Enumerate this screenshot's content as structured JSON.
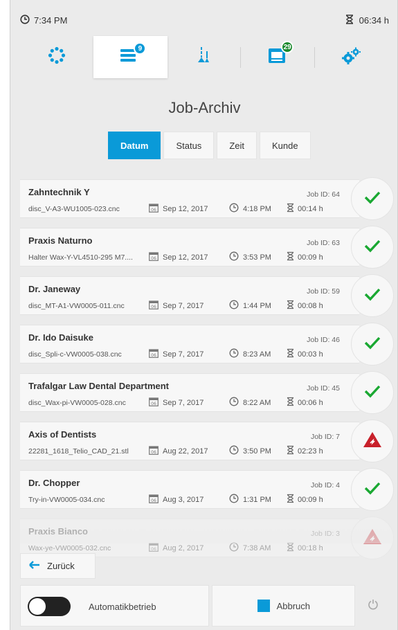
{
  "status_bar": {
    "time": "7:34 PM",
    "remaining": "06:34 h"
  },
  "nav": {
    "tabs": [
      {
        "icon": "dots-circle-icon",
        "badge": ""
      },
      {
        "icon": "job-list-icon",
        "badge": "9"
      },
      {
        "icon": "tools-icon",
        "badge": ""
      },
      {
        "icon": "machine-icon",
        "badge": "29"
      },
      {
        "icon": "gears-icon",
        "badge": ""
      }
    ],
    "active_index": 1
  },
  "page_title": "Job-Archiv",
  "sort": {
    "options": [
      "Datum",
      "Status",
      "Zeit",
      "Kunde"
    ],
    "active": "Datum"
  },
  "jobs": [
    {
      "customer": "Zahntechnik Y",
      "file": "disc_V-A3-WU1005-023.cnc",
      "date": "Sep 12, 2017",
      "time": "4:18 PM",
      "duration": "00:14 h",
      "job_id": "Job ID: 64",
      "status": "success"
    },
    {
      "customer": "Praxis Naturno",
      "file": "Halter Wax-Y-VL4510-295 M7....",
      "date": "Sep 12, 2017",
      "time": "3:53 PM",
      "duration": "00:09 h",
      "job_id": "Job ID: 63",
      "status": "success"
    },
    {
      "customer": "Dr. Janeway",
      "file": "disc_MT-A1-VW0005-011.cnc",
      "date": "Sep 7, 2017",
      "time": "1:44 PM",
      "duration": "00:08 h",
      "job_id": "Job ID: 59",
      "status": "success"
    },
    {
      "customer": "Dr. Ido Daisuke",
      "file": "disc_Spli-c-VW0005-038.cnc",
      "date": "Sep 7, 2017",
      "time": "8:23 AM",
      "duration": "00:03 h",
      "job_id": "Job ID: 46",
      "status": "success"
    },
    {
      "customer": "Trafalgar Law Dental Department",
      "file": "disc_Wax-pi-VW0005-028.cnc",
      "date": "Sep 7, 2017",
      "time": "8:22 AM",
      "duration": "00:06 h",
      "job_id": "Job ID: 45",
      "status": "success"
    },
    {
      "customer": "Axis of Dentists",
      "file": "22281_1618_Telio_CAD_21.stl",
      "date": "Aug 22, 2017",
      "time": "3:50 PM",
      "duration": "02:23 h",
      "job_id": "Job ID: 7",
      "status": "error"
    },
    {
      "customer": "Dr. Chopper",
      "file": "Try-in-VW0005-034.cnc",
      "date": "Aug 3, 2017",
      "time": "1:31 PM",
      "duration": "00:09 h",
      "job_id": "Job ID: 4",
      "status": "success"
    },
    {
      "customer": "Praxis Bianco",
      "file": "Wax-ye-VW0005-032.cnc",
      "date": "Aug 2, 2017",
      "time": "7:38 AM",
      "duration": "00:18 h",
      "job_id": "Job ID: 3",
      "status": "error"
    }
  ],
  "calendar_day": "06",
  "back_label": "Zurück",
  "auto_mode": {
    "label": "Automatikbetrieb",
    "enabled": false
  },
  "abort_label": "Abbruch",
  "colors": {
    "accent": "#0a9ad8",
    "success": "#1aa832",
    "error": "#c8202a",
    "badge": "#1c8a2e"
  }
}
